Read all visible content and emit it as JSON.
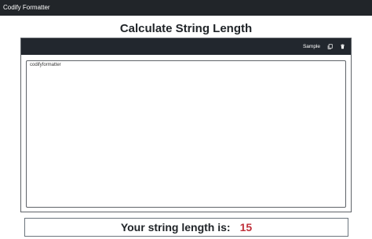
{
  "navbar": {
    "brand": "Codify Formatter"
  },
  "page": {
    "title": "Calculate String Length"
  },
  "editor": {
    "toolbar": {
      "sample_label": "Sample",
      "copy_icon": "copy-icon",
      "delete_icon": "trash-icon"
    },
    "value": "codifyformatter"
  },
  "result": {
    "label": "Your string length is:",
    "value": "15"
  },
  "colors": {
    "navbar_bg": "#212529",
    "toolbar_bg": "#22272e",
    "result_value": "#c0303a"
  }
}
